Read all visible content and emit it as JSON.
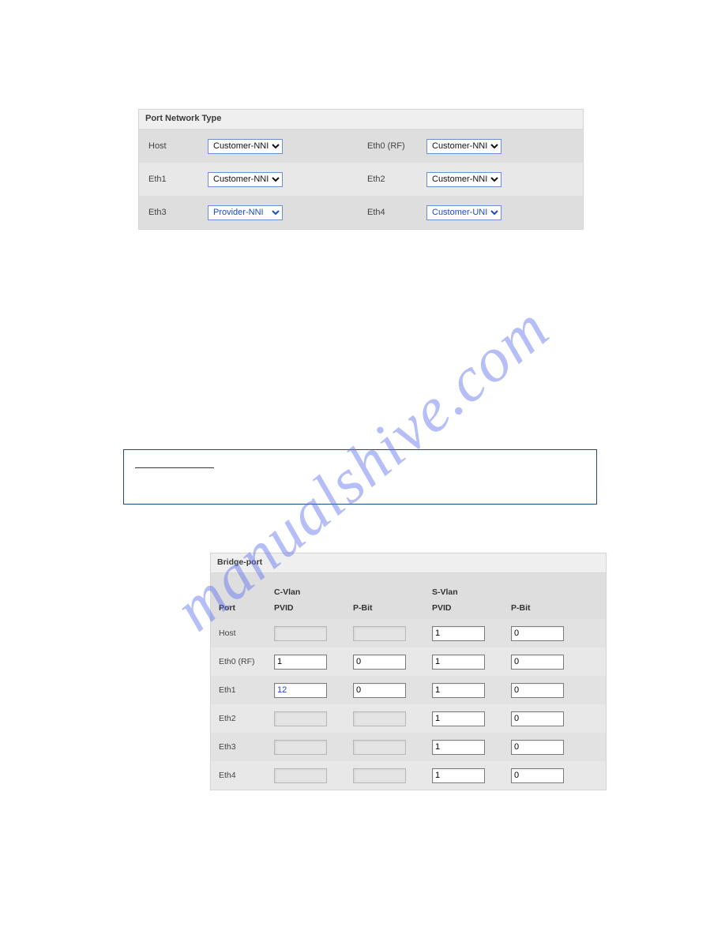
{
  "portNetworkType": {
    "title": "Port Network Type",
    "rows": [
      {
        "leftLabel": "Host",
        "leftValue": "Customer-NNI",
        "leftStyle": "black",
        "rightLabel": "Eth0 (RF)",
        "rightValue": "Customer-NNI",
        "rightStyle": "black"
      },
      {
        "leftLabel": "Eth1",
        "leftValue": "Customer-NNI",
        "leftStyle": "black",
        "rightLabel": "Eth2",
        "rightValue": "Customer-NNI",
        "rightStyle": "black"
      },
      {
        "leftLabel": "Eth3",
        "leftValue": "Provider-NNI",
        "leftStyle": "blue",
        "rightLabel": "Eth4",
        "rightValue": "Customer-UNI",
        "rightStyle": "blue"
      }
    ],
    "options": [
      "Customer-NNI",
      "Customer-UNI",
      "Provider-NNI"
    ]
  },
  "bridgePort": {
    "title": "Bridge-port",
    "groupHeaders": {
      "c": "C-Vlan",
      "s": "S-Vlan"
    },
    "colHeaders": {
      "port": "Port",
      "cpvid": "PVID",
      "cpbit": "P-Bit",
      "spvid": "PVID",
      "spbit": "P-Bit"
    },
    "rows": [
      {
        "port": "Host",
        "cpvid": "",
        "cpbit": "",
        "cro": true,
        "spvid": "1",
        "spbit": "0"
      },
      {
        "port": "Eth0 (RF)",
        "cpvid": "1",
        "cpbit": "0",
        "cro": false,
        "spvid": "1",
        "spbit": "0"
      },
      {
        "port": "Eth1",
        "cpvid": "12",
        "cpbit": "0",
        "cro": false,
        "cblue": true,
        "spvid": "1",
        "spbit": "0"
      },
      {
        "port": "Eth2",
        "cpvid": "",
        "cpbit": "",
        "cro": true,
        "spvid": "1",
        "spbit": "0"
      },
      {
        "port": "Eth3",
        "cpvid": "",
        "cpbit": "",
        "cro": true,
        "spvid": "1",
        "spbit": "0"
      },
      {
        "port": "Eth4",
        "cpvid": "",
        "cpbit": "",
        "cro": true,
        "spvid": "1",
        "spbit": "0"
      }
    ]
  },
  "watermark": "manualshive.com"
}
